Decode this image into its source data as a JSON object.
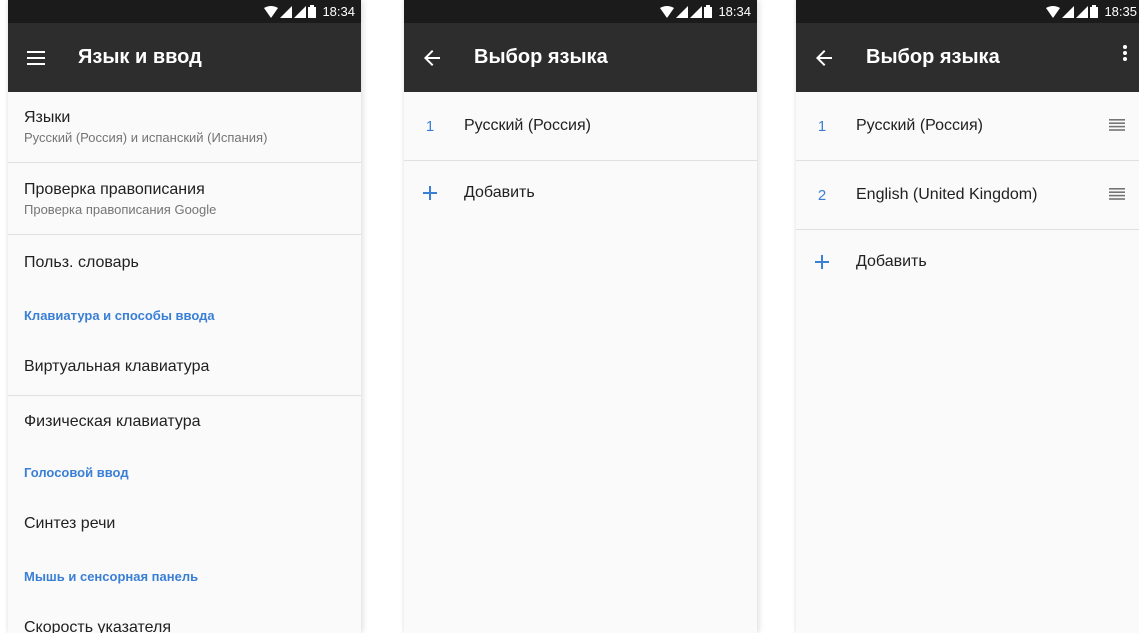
{
  "status": {
    "time1": "18:34",
    "time2": "18:34",
    "time3": "18:35"
  },
  "screen1": {
    "title": "Язык и ввод",
    "menu_icon": "hamburger-menu-icon",
    "items": [
      {
        "primary": "Языки",
        "secondary": "Русский (Россия) и испанский (Испания)"
      },
      {
        "primary": "Проверка правописания",
        "secondary": "Проверка правописания Google"
      },
      {
        "primary": "Польз. словарь"
      },
      {
        "category": "Клавиатура и способы ввода"
      },
      {
        "primary": "Виртуальная клавиатура"
      },
      {
        "primary": "Физическая клавиатура"
      },
      {
        "category": "Голосовой ввод"
      },
      {
        "primary": "Синтез речи"
      },
      {
        "category": "Мышь и сенсорная панель"
      },
      {
        "primary": "Скорость указателя"
      }
    ]
  },
  "screen2": {
    "title": "Выбор языка",
    "languages": [
      {
        "num": "1",
        "name": "Русский (Россия)"
      }
    ],
    "add_label": "Добавить"
  },
  "screen3": {
    "title": "Выбор языка",
    "languages": [
      {
        "num": "1",
        "name": "Русский (Россия)"
      },
      {
        "num": "2",
        "name": "English (United Kingdom)"
      }
    ],
    "add_label": "Добавить"
  },
  "colors": {
    "accent": "#3a7fd6",
    "appbar": "#2d2d2d",
    "statusbar": "#1b1b1b"
  }
}
